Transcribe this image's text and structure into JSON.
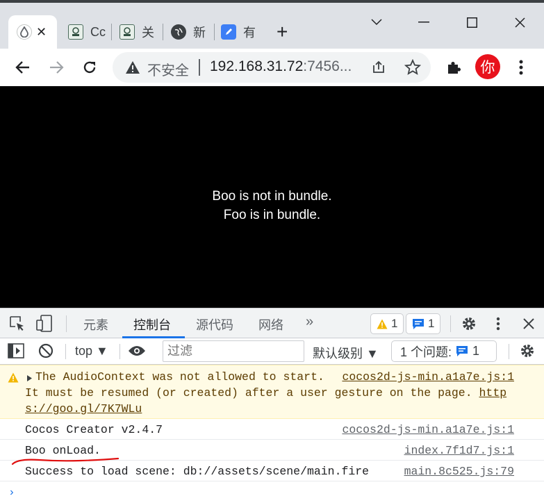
{
  "browser": {
    "tabs": [
      {
        "title": "",
        "icon": "water-drop-icon",
        "active": true
      },
      {
        "title": "Cc",
        "icon": "cocos-icon"
      },
      {
        "title": "关",
        "icon": "cocos-icon"
      },
      {
        "title": "新",
        "icon": "globe-icon"
      },
      {
        "title": "有",
        "icon": "edit-doc-icon"
      }
    ],
    "new_tab": "+",
    "omnibox": {
      "security_label": "不安全",
      "url_host": "192.168.31.72",
      "url_rest": ":7456..."
    },
    "profile_initial": "你"
  },
  "page": {
    "lines": [
      "Boo is not in bundle.",
      "Foo is in bundle."
    ]
  },
  "devtools": {
    "tabs": [
      "元素",
      "控制台",
      "源代码",
      "网络"
    ],
    "active_tab": "控制台",
    "more": "»",
    "warn_count": "1",
    "info_count": "1",
    "context": "top ▼",
    "filter_placeholder": "过滤",
    "level": "默认级别 ▼",
    "issues_label": "1 个问题:",
    "issues_count": "1"
  },
  "console": {
    "messages": [
      {
        "level": "warning",
        "line1": "The AudioContext was not allowed to start.",
        "line2_text": "It must be resumed (or created) after a user gesture on the page. ",
        "line2_link": "http",
        "line3_link": "s://goo.gl/7K7WLu",
        "source": "cocos2d-js-min.a1a7e.js:1"
      },
      {
        "level": "log",
        "text": "Cocos Creator v2.4.7",
        "source": "cocos2d-js-min.a1a7e.js:1"
      },
      {
        "level": "log",
        "text": "Boo onLoad.",
        "source": "index.7f1d7.js:1"
      },
      {
        "level": "log",
        "text": "Success to load scene: db://assets/scene/main.fire",
        "source": "main.8c525.js:79"
      }
    ],
    "prompt": "›"
  },
  "colors": {
    "accent": "#1a73e8",
    "warning_bg": "#fffbe5",
    "profile": "#e8121c",
    "annotation": "#e01010"
  }
}
